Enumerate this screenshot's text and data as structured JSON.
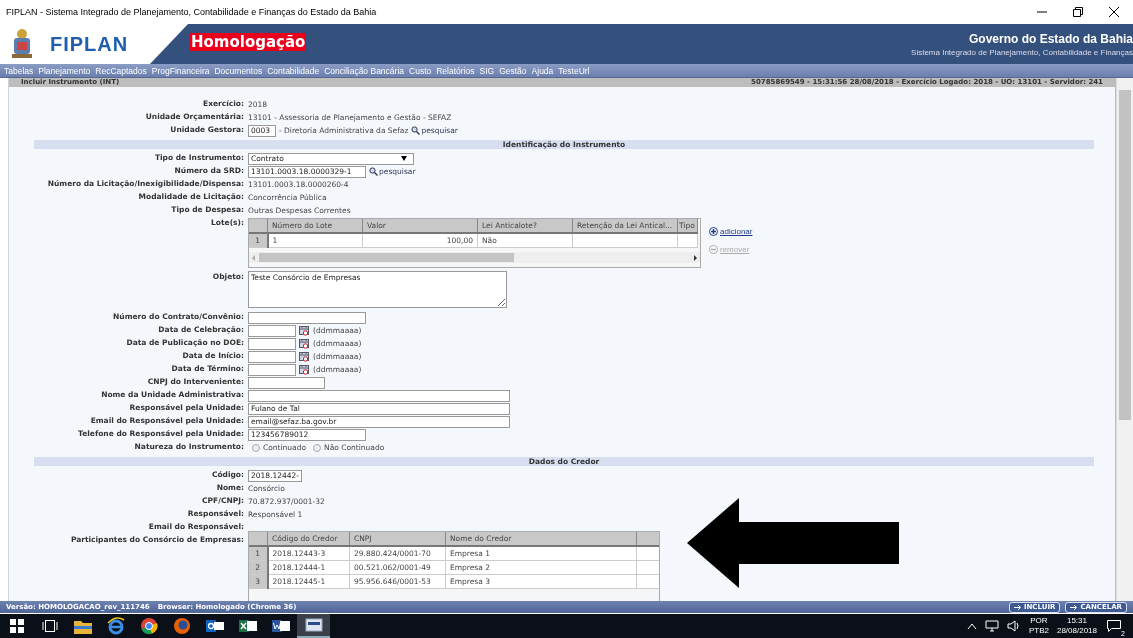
{
  "window": {
    "title": "FIPLAN - Sistema Integrado de Planejamento, Contabilidade e Finanças do Estado da Bahia"
  },
  "header": {
    "logo_text": "FIPLAN",
    "environment": "Homologação",
    "org_name": "Governo do Estado da Bahia",
    "subtitle": "Sistema Integrado de Planejamento, Contabilidade e Finanças"
  },
  "menu": [
    "Tabelas",
    "Planejamento",
    "RecCaptados",
    "ProgFinanceira",
    "Documentos",
    "Contabilidade",
    "Conciliação Bancária",
    "Custo",
    "Relatórios",
    "SIG",
    "Gestão",
    "Ajuda",
    "TesteUrl"
  ],
  "page": {
    "title": "Incluir Instrumento (INT)",
    "session_info": "50785869549 - 15:31:56 28/08/2018 - Exercício Logado: 2018 - UO: 13101 - Servidor: 241"
  },
  "sections": [
    {
      "fields": [
        {
          "kind": "text",
          "label": "Exercício:",
          "value": "2018"
        },
        {
          "kind": "text",
          "label": "Unidade Orçamentária:",
          "value": "13101 - Assessoria de Planejamento e Gestão - SEFAZ"
        },
        {
          "kind": "code_input",
          "label": "Unidade Gestora:",
          "value": "0003",
          "suffix": "- Diretoria Administrativa da Sefaz",
          "link": "pesquisar"
        }
      ]
    },
    {
      "title": "Identificação do Instrumento",
      "fields": [
        {
          "kind": "select",
          "label": "Tipo de Instrumento:",
          "value": "Contrato"
        },
        {
          "kind": "input",
          "label": "Número da SRD:",
          "value": "13101.0003.18.0000329-1",
          "link": "pesquisar"
        },
        {
          "kind": "text",
          "label": "Número da Licitação/Inexigibilidade/Dispensa:",
          "value": "13101.0003.18.0000260-4"
        },
        {
          "kind": "text",
          "label": "Modalidade de Licitação:",
          "value": "Concorrência Pública"
        },
        {
          "kind": "text",
          "label": "Tipo de Despesa:",
          "value": "Outras Despesas Correntes"
        },
        {
          "kind": "lot_grid",
          "label": "Lote(s):",
          "columns": [
            "Número do Lote",
            "Valor",
            "Lei Anticalote?",
            "Retenção da Lei Antical...",
            "Tipo"
          ],
          "rows": [
            {
              "number": "1",
              "cells": [
                "1",
                "100,00",
                "Não",
                "",
                ""
              ]
            }
          ],
          "actions": [
            {
              "label": "adicionar",
              "disabled": false
            },
            {
              "label": "remover",
              "disabled": true
            }
          ]
        },
        {
          "kind": "textarea",
          "label": "Objeto:",
          "value": "Teste Consórcio de Empresas"
        },
        {
          "kind": "input",
          "label": "Número do Contrato/Convênio:"
        },
        {
          "kind": "date",
          "label": "Data de Celebração:",
          "hint": "(ddmmaaaa)"
        },
        {
          "kind": "date",
          "label": "Data de Publicação no DOE:",
          "hint": "(ddmmaaaa)"
        },
        {
          "kind": "date",
          "label": "Data de Início:",
          "hint": "(ddmmaaaa)"
        },
        {
          "kind": "date",
          "label": "Data de Término:",
          "hint": "(ddmmaaaa)"
        },
        {
          "kind": "short_input",
          "label": "CNPJ do Interveniente:"
        },
        {
          "kind": "wide_input",
          "label": "Nome da Unidade Administrativa:"
        },
        {
          "kind": "wide_input",
          "label": "Responsável pela Unidade:",
          "value": "Fulano de Tal"
        },
        {
          "kind": "wide_input",
          "label": "Email do Responsável pela Unidade:",
          "value": "email@sefaz.ba.gov.br"
        },
        {
          "kind": "input",
          "label": "Telefone do Responsável pela Unidade:",
          "value": "123456789012"
        },
        {
          "kind": "radio",
          "label": "Natureza do Instrumento:",
          "options": [
            {
              "label": "Continuado",
              "selected": false
            },
            {
              "label": "Não Continuado",
              "selected": false
            }
          ]
        }
      ]
    },
    {
      "title": "Dados do Credor",
      "fields": [
        {
          "kind": "id_input",
          "label": "Código:",
          "value": "2018.12442-"
        },
        {
          "kind": "text",
          "label": "Nome:",
          "value": "Consórcio"
        },
        {
          "kind": "text",
          "label": "CPF/CNPJ:",
          "value": "70.872.937/0001-32"
        },
        {
          "kind": "text",
          "label": "Responsável:",
          "value": "Responsável 1"
        },
        {
          "kind": "text",
          "label": "Email do Responsável:"
        },
        {
          "kind": "member_grid",
          "label": "Participantes do Consórcio de Empresas:",
          "columns": [
            "Código do Credor",
            "CNPJ",
            "Nome do Credor"
          ],
          "rows": [
            {
              "number": "1",
              "cells": [
                "2018.12443-3",
                "29.880.424/0001-70",
                "Empresa 1"
              ]
            },
            {
              "number": "2",
              "cells": [
                "2018.12444-1",
                "00.521.062/0001-49",
                "Empresa 2"
              ]
            },
            {
              "number": "3",
              "cells": [
                "2018.12445-1",
                "95.956.646/0001-53",
                "Empresa 3"
              ]
            }
          ]
        }
      ]
    }
  ],
  "footer": {
    "version": "Versão: HOMOLOGACAO_rev_111746",
    "browser": "Browser: Homologado (Chrome 36)",
    "buttons": [
      "INCLUIR",
      "CANCELAR"
    ]
  },
  "taskbar": {
    "apps": [
      {
        "active": false
      },
      {
        "active": false
      },
      {
        "active": false
      },
      {
        "active": false
      },
      {
        "active": false
      },
      {
        "active": false
      },
      {
        "active": false
      },
      {
        "active": false
      },
      {
        "active": true
      }
    ],
    "language": "POR",
    "layout": "PTB2",
    "time": "15:31",
    "date": "28/08/2018",
    "notifications": "2"
  }
}
